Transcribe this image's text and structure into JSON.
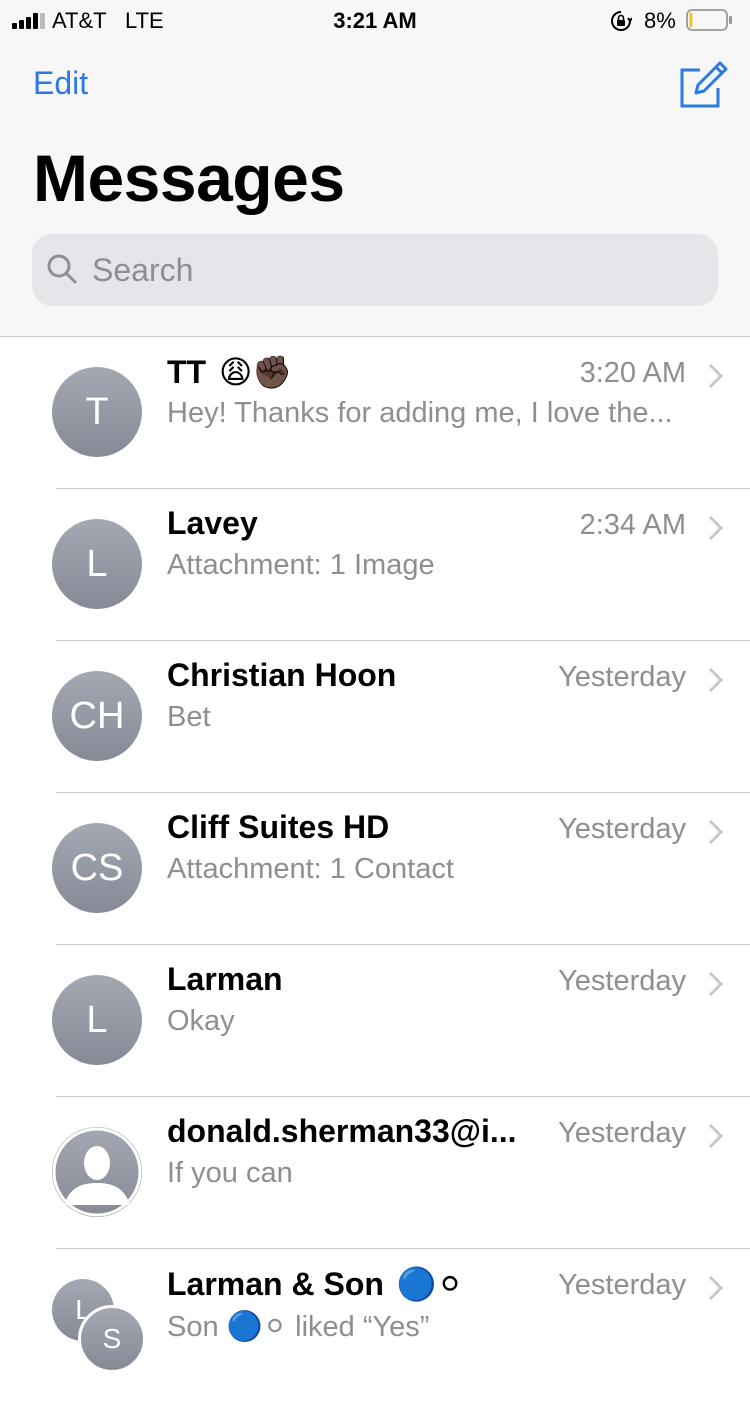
{
  "status_bar": {
    "carrier": "AT&T",
    "network": "LTE",
    "time": "3:21 AM",
    "battery_percent": "8%",
    "battery_level": 0.08,
    "signal_bars": 4
  },
  "header": {
    "edit_label": "Edit",
    "title": "Messages",
    "search_placeholder": "Search"
  },
  "colors": {
    "accent": "#2a7ae2",
    "battery_low": "#f0c419"
  },
  "conversations": [
    {
      "avatar": "T",
      "name": "TT",
      "emoji": "😩✊🏿",
      "time": "3:20 AM",
      "preview": "Hey! Thanks for adding me, I love the..."
    },
    {
      "avatar": "L",
      "name": "Lavey",
      "time": "2:34 AM",
      "preview": "Attachment: 1 Image"
    },
    {
      "avatar": "CH",
      "name": "Christian Hoon",
      "time": "Yesterday",
      "preview": "Bet"
    },
    {
      "avatar": "CS",
      "name": "Cliff Suites HD",
      "time": "Yesterday",
      "preview": "Attachment: 1 Contact"
    },
    {
      "avatar": "L",
      "name": "Larman",
      "time": "Yesterday",
      "preview": "Okay"
    },
    {
      "avatar_icon": "person-silhouette-icon",
      "name": "donald.sherman33@i...",
      "time": "Yesterday",
      "preview": "If you can"
    },
    {
      "avatar": "L",
      "avatar2": "S",
      "name": "Larman & Son",
      "emoji": "🔵⚪",
      "time": "Yesterday",
      "preview": "Son 🔵⚪ liked “Yes”"
    }
  ]
}
